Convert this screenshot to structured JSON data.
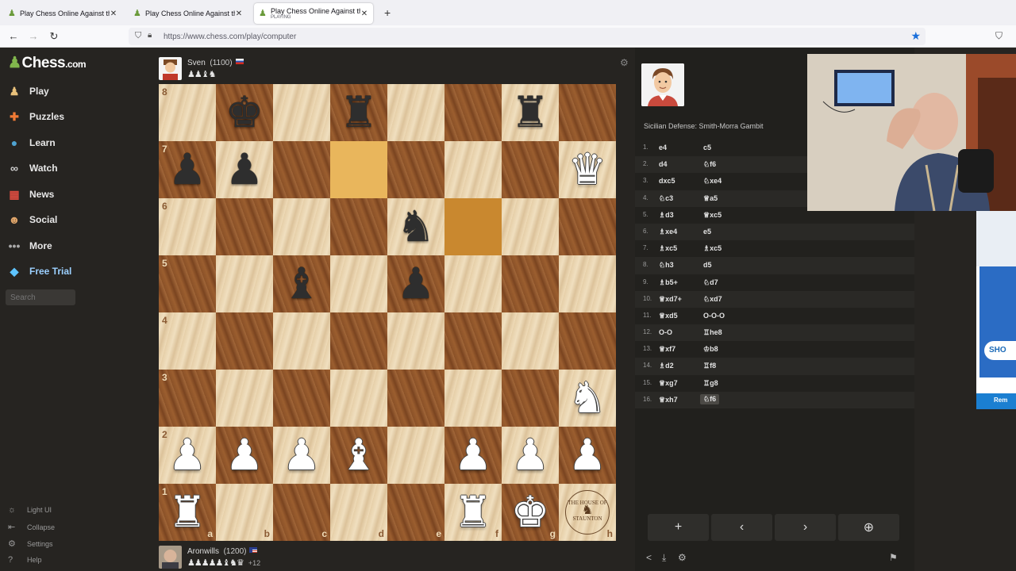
{
  "browser": {
    "tabs": [
      {
        "title": "Play Chess Online Against the C",
        "subtitle": "",
        "active": false
      },
      {
        "title": "Play Chess Online Against the C",
        "subtitle": "",
        "active": false
      },
      {
        "title": "Play Chess Online Against the C",
        "subtitle": "PLAYING",
        "active": true
      }
    ],
    "url": "https://www.chess.com/play/computer"
  },
  "sidebar": {
    "logo": "Chess",
    "logo_suffix": ".com",
    "items": [
      {
        "label": "Play",
        "icon": "play-icon"
      },
      {
        "label": "Puzzles",
        "icon": "puzzle-icon"
      },
      {
        "label": "Learn",
        "icon": "learn-icon"
      },
      {
        "label": "Watch",
        "icon": "watch-icon"
      },
      {
        "label": "News",
        "icon": "news-icon"
      },
      {
        "label": "Social",
        "icon": "social-icon"
      },
      {
        "label": "More",
        "icon": "more-icon"
      },
      {
        "label": "Free Trial",
        "icon": "diamond-icon"
      }
    ],
    "search_placeholder": "Search",
    "footer": [
      "Light UI",
      "Collapse",
      "Settings",
      "Help"
    ]
  },
  "opponent": {
    "name": "Sven",
    "rating": "(1100)",
    "captured": "♟♟♝♞"
  },
  "player": {
    "name": "Aronwills",
    "rating": "(1200)",
    "captured": "♟♟♟♟♟♝♞♛",
    "advantage": "+12"
  },
  "board": {
    "files": [
      "a",
      "b",
      "c",
      "d",
      "e",
      "f",
      "g",
      "h"
    ],
    "ranks": [
      "8",
      "7",
      "6",
      "5",
      "4",
      "3",
      "2",
      "1"
    ],
    "pieces": {
      "b8": "bk",
      "d8": "br",
      "g8": "br",
      "a7": "bp",
      "b7": "bp",
      "h7": "wq",
      "e6": "bn",
      "c5": "bb",
      "e5": "bp",
      "h3": "wn",
      "a2": "wp",
      "b2": "wp",
      "c2": "wp",
      "d2": "wb",
      "f2": "wp",
      "g2": "wp",
      "h2": "wp",
      "a1": "wr",
      "f1": "wr",
      "g1": "wk"
    },
    "highlight": [
      "d7",
      "f6"
    ],
    "seal_text": [
      "THE HOUSE OF",
      "♞",
      "STAUNTON"
    ]
  },
  "panel": {
    "opening": "Sicilian Defense: Smith-Morra Gambit",
    "moves": [
      {
        "n": "1.",
        "w": "e4",
        "b": "c5"
      },
      {
        "n": "2.",
        "w": "d4",
        "b": "♘f6"
      },
      {
        "n": "3.",
        "w": "dxc5",
        "b": "♘xe4"
      },
      {
        "n": "4.",
        "w": "♘c3",
        "b": "♕a5"
      },
      {
        "n": "5.",
        "w": "♗d3",
        "b": "♕xc5"
      },
      {
        "n": "6.",
        "w": "♗xe4",
        "b": "e5"
      },
      {
        "n": "7.",
        "w": "♗xc5",
        "b": "♗xc5"
      },
      {
        "n": "8.",
        "w": "♘h3",
        "b": "d5"
      },
      {
        "n": "9.",
        "w": "♗b5+",
        "b": "♘d7"
      },
      {
        "n": "10.",
        "w": "♕xd7+",
        "b": "♘xd7"
      },
      {
        "n": "11.",
        "w": "♕xd5",
        "b": "O-O-O"
      },
      {
        "n": "12.",
        "w": "O-O",
        "b": "♖he8"
      },
      {
        "n": "13.",
        "w": "♕xf7",
        "b": "♔b8"
      },
      {
        "n": "14.",
        "w": "♗d2",
        "b": "♖f8"
      },
      {
        "n": "15.",
        "w": "♕xg7",
        "b": "♖g8"
      },
      {
        "n": "16.",
        "w": "♕xh7",
        "b": "♘f6"
      }
    ],
    "controls": [
      "+",
      "‹",
      "›",
      "⊕"
    ]
  },
  "ad": {
    "shop": "SHO",
    "bottom": "Rem"
  }
}
